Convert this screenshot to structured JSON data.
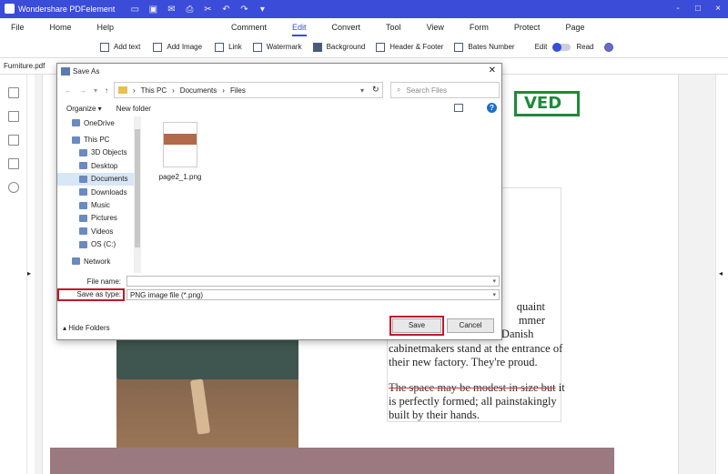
{
  "app": {
    "title": "Wondershare PDFelement",
    "quick_access": [
      "folder-icon",
      "save-icon",
      "mail-icon",
      "print-icon",
      "scissors-icon",
      "undo-icon",
      "redo-icon",
      "chevron-down-icon"
    ],
    "window_controls": [
      "-",
      "□",
      "×"
    ]
  },
  "menu": {
    "left": [
      "File",
      "Home",
      "Help"
    ],
    "tabs": [
      "Comment",
      "Edit",
      "Convert",
      "Tool",
      "View",
      "Form",
      "Protect",
      "Page"
    ],
    "active_tab": "Edit"
  },
  "toolbar": {
    "add_text": "Add text",
    "add_image": "Add Image",
    "link": "Link",
    "watermark": "Watermark",
    "background": "Background",
    "header_footer": "Header & Footer",
    "bates_number": "Bates Number",
    "edit": "Edit",
    "read": "Read"
  },
  "document": {
    "tab": "Furniture.pdf",
    "stamp": "VED",
    "text_lines": [
      "quaint",
      "mmer",
      "of 1930, a pair of young Danish",
      "cabinetmakers stand at the entrance of",
      "their new factory. They're proud."
    ],
    "strike_text": "The space may be modest in size but",
    "after_strike": " it is perfectly formed; all painstakingly built by their hands."
  },
  "dialog": {
    "title": "Save As",
    "breadcrumb": [
      "This PC",
      "Documents",
      "Files"
    ],
    "search_placeholder": "Search Files",
    "organize": "Organize ▾",
    "new_folder": "New folder",
    "nav_items": [
      {
        "label": "OneDrive",
        "icon": "cloud-icon"
      },
      {
        "label": "This PC",
        "icon": "computer-icon"
      },
      {
        "label": "3D Objects",
        "icon": "cube-icon"
      },
      {
        "label": "Desktop",
        "icon": "desktop-icon"
      },
      {
        "label": "Documents",
        "icon": "documents-icon"
      },
      {
        "label": "Downloads",
        "icon": "download-icon"
      },
      {
        "label": "Music",
        "icon": "music-icon"
      },
      {
        "label": "Pictures",
        "icon": "pictures-icon"
      },
      {
        "label": "Videos",
        "icon": "video-icon"
      },
      {
        "label": "OS (C:)",
        "icon": "drive-icon"
      },
      {
        "label": "Network",
        "icon": "network-icon"
      }
    ],
    "selected_nav": "Documents",
    "file": {
      "name": "page2_1.png"
    },
    "file_name_label": "File name:",
    "file_name_value": "",
    "save_type_label": "Save as type:",
    "save_type_value": "PNG image file (*.png)",
    "hide_folders": "Hide Folders",
    "save": "Save",
    "cancel": "Cancel"
  },
  "colors": {
    "accent": "#3a4cd8",
    "highlight_red": "#c0182b",
    "stamp_green": "#1e8a3a"
  }
}
